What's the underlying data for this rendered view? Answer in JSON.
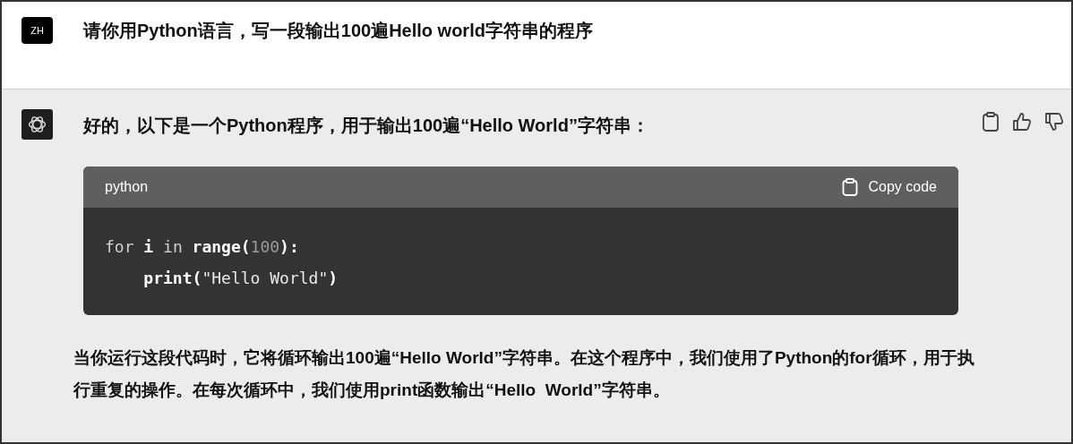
{
  "user_message": {
    "avatar": "ZH",
    "text": "请你用Python语言，写一段输出100遍Hello world字符串的程序"
  },
  "assistant_message": {
    "intro": "好的，以下是一个Python程序，用于输出100遍“Hello World”字符串：",
    "code_block": {
      "language": "python",
      "copy_label": "Copy code",
      "lines": [
        [
          {
            "kind": "keyword",
            "text": "for "
          },
          {
            "kind": "name",
            "text": "i"
          },
          {
            "kind": "keyword",
            "text": " in "
          },
          {
            "kind": "builtin",
            "text": "range("
          },
          {
            "kind": "number",
            "text": "100"
          },
          {
            "kind": "builtin",
            "text": "):"
          }
        ],
        [
          {
            "kind": "builtin",
            "text": "    print("
          },
          {
            "kind": "string",
            "text": "\"Hello World\""
          },
          {
            "kind": "builtin",
            "text": ")"
          }
        ]
      ]
    },
    "explanation": "当你运行这段代码时，它将循环输出100遍“Hello World”字符串。在这个程序中，我们使用了Python的for循环，用于执行重复的操作。在每次循环中，我们使用print函数输出“Hello  World”字符串。"
  }
}
